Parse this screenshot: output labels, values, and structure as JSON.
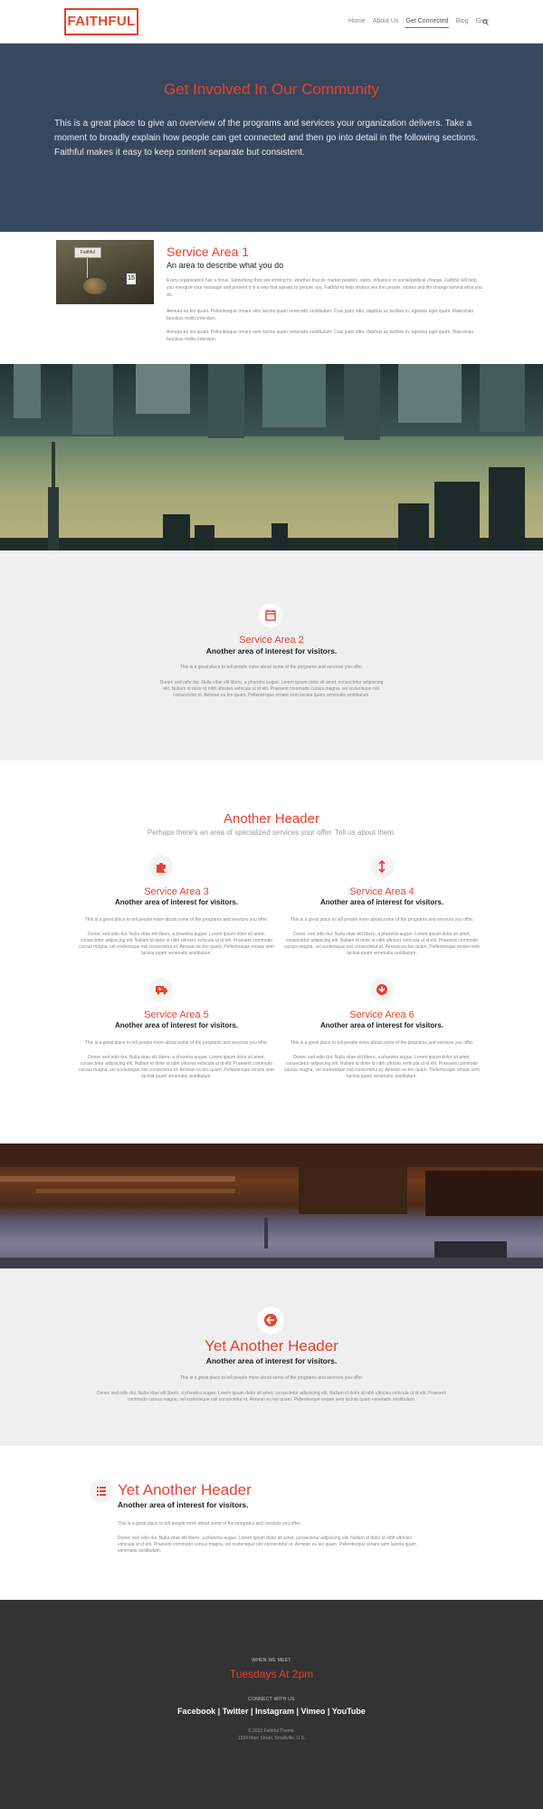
{
  "header": {
    "logo": "FAITHFUL",
    "nav": [
      "Home",
      "About Us",
      "Get Connected",
      "Blog",
      "Give"
    ],
    "active_nav": "Get Connected"
  },
  "hero": {
    "title": "Get Involved In Our Community",
    "body": "This is a great place to give an overview of the programs and services your organization delivers. Take a moment to broadly explain how people can get connected and then go into detail in the following sections. Faithful makes it easy to keep content separate but consistent."
  },
  "service1": {
    "title": "Service Area 1",
    "subtitle": "An area to describe what you do",
    "p1": "Every organization has a focus. Something they are striving for, whether that be market position, sales, influence or social/political change. Faithful will help you energize your message and present it in a way that speaks to people, too. Faithful to help visitors see the people, stories and life change behind what you do.",
    "p2": "Aenean eu leo quam. Pellentesque ornare sem lacinia quam venenatis vestibulum. Cras justo odio, dapibus ac facilisis in, egestas eget quam. Maecenas faucibus mollis interdum.",
    "p3": "Aenean eu leo quam. Pellentesque ornare sem lacinia quam venenatis vestibulum. Cras justo odio, dapibus ac facilisis in, egestas eget quam. Maecenas faucibus mollis interdum.",
    "image_flag": "Faithful",
    "image_card": "15"
  },
  "service2": {
    "title": "Service Area 2",
    "subtitle": "Another area of interest for visitors.",
    "p1": "This is a great place to tell people more about some of the programs and services you offer.",
    "p2": "Donec sed odio dui. Nulla vitae elit libero, a pharetra augue. Lorem ipsum dolor sit amet, consectetur adipiscing elit. Nullam id dolor id nibh ultricies vehicula ut id elit. Praesent commodo cursus magna, vel scelerisque nisl consectetur et. Aenean eu leo quam. Pellentesque ornare sem lacinia quam venenatis vestibulum."
  },
  "another": {
    "title": "Another Header",
    "subtitle": "Perhaps there's an area of specialized services your offer. Tell us about them.",
    "areas": [
      {
        "title": "Service Area 3",
        "subtitle": "Another area of interest for visitors.",
        "icon": "puzzle-icon"
      },
      {
        "title": "Service Area 4",
        "subtitle": "Another area of interest for visitors.",
        "icon": "arrows-vertical-icon"
      },
      {
        "title": "Service Area 5",
        "subtitle": "Another area of interest for visitors.",
        "icon": "ambulance-icon"
      },
      {
        "title": "Service Area 6",
        "subtitle": "Another area of interest for visitors.",
        "icon": "arrow-circle-down-icon"
      }
    ],
    "p1": "This is a great place to tell people more about some of the programs and services you offer.",
    "p2": "Donec sed odio dui. Nulla vitae elit libero, a pharetra augue. Lorem ipsum dolor sit amet, consectetur adipiscing elit. Nullam id dolor id nibh ultricies vehicula ut id elit. Praesent commodo cursus magna, vel scelerisque nisl consectetur et. Aenean eu leo quam. Pellentesque ornare sem lacinia quam venenatis vestibulum."
  },
  "yet1": {
    "title": "Yet Another Header",
    "subtitle": "Another area of interest for visitors.",
    "p1": "This is a great place to tell people more about some of the programs and services you offer.",
    "p2": "Donec sed odio dui. Nulla vitae elit libero, a pharetra augue. Lorem ipsum dolor sit amet, consectetur adipiscing elit. Nullam id dolor id nibh ultricies vehicula ut id elit. Praesent commodo cursus magna, vel scelerisque nisl consectetur et. Aenean eu leo quam. Pellentesque ornare sem lacinia quam venenatis vestibulum."
  },
  "yet2": {
    "title": "Yet Another Header",
    "subtitle": "Another area of interest for visitors.",
    "p1": "This is a great place to tell people more about some of the programs and services you offer.",
    "p2": "Donec sed odio dui. Nulla vitae elit libero, a pharetra augue. Lorem ipsum dolor sit amet, consectetur adipiscing elit. Nullam id dolor id nibh ultricies vehicula ut id elit. Praesent commodo cursus magna, vel scelerisque nisl consectetur et. Aenean eu leo quam. Pellentesque ornare sem lacinia quam venenatis vestibulum."
  },
  "footer": {
    "when_label": "WHEN WE MEET",
    "when": "Tuesdays At 2pm",
    "connect_label": "CONNECT WITH US",
    "links": [
      "Facebook",
      "Twitter",
      "Instagram",
      "Vimeo",
      "YouTube"
    ],
    "separator": " | ",
    "copyright": "© 2013 Faithful Theme.",
    "address": "1234 Main Street, Smallville, U.S."
  },
  "colors": {
    "accent": "#e8412c",
    "hero_bg": "#364760",
    "footer_bg": "#333333",
    "section_gray": "#efefef"
  }
}
